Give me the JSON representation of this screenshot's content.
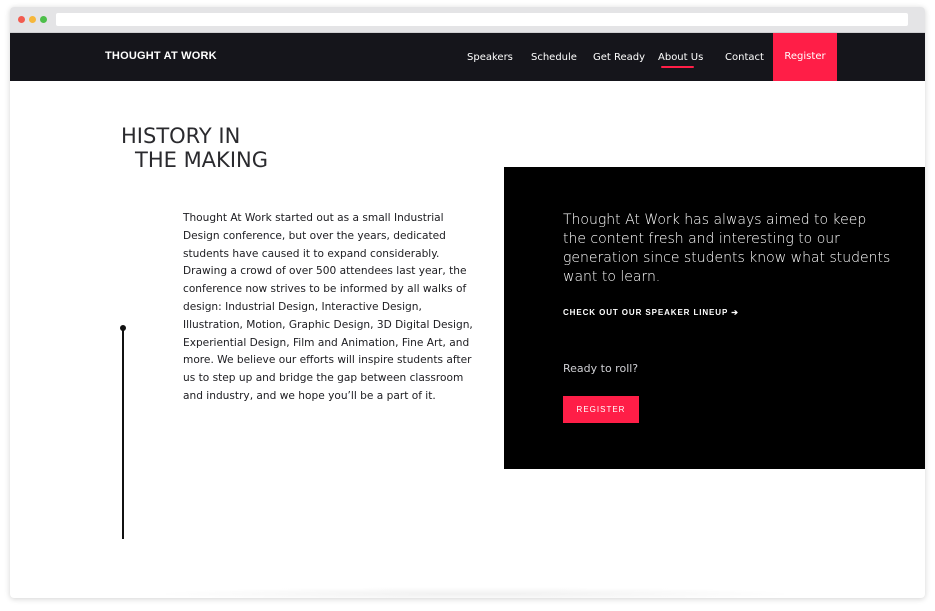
{
  "nav": {
    "brand": "THOUGHT AT WORK",
    "links": [
      {
        "label": "Speakers"
      },
      {
        "label": "Schedule"
      },
      {
        "label": "Get Ready"
      },
      {
        "label": "About Us",
        "active": true
      },
      {
        "label": "Contact"
      }
    ],
    "register_label": "Register"
  },
  "history": {
    "heading_line1": "HISTORY IN",
    "heading_line2": "THE MAKING",
    "body": "Thought At Work started out as a small Industrial Design conference, but over the years, dedicated students have caused it to expand considerably. Drawing a crowd of over 500 attendees last year, the conference now strives to be informed by all walks of design: Industrial Design, Interactive Design, Illustration, Motion, Graphic Design, 3D Digital Design, Experiential Design, Film and Animation, Fine Art, and more. We believe our efforts will inspire students after us to step up and bridge the gap between classroom and industry, and we hope you’ll be a part of it."
  },
  "promo": {
    "quote": "Thought At Work has always aimed to keep the content fresh and interesting to our generation since students know what students want to learn.",
    "lineup_link": "CHECK OUT OUR SPEAKER LINEUP ➔",
    "ready_text": "Ready to roll?",
    "register_button": "REGISTER"
  },
  "colors": {
    "accent": "#ff1e47",
    "nav_bg": "#15151b",
    "panel_bg": "#000000"
  },
  "icons": {
    "window_controls": [
      "close-dot-icon",
      "minimize-dot-icon",
      "maximize-dot-icon"
    ]
  }
}
